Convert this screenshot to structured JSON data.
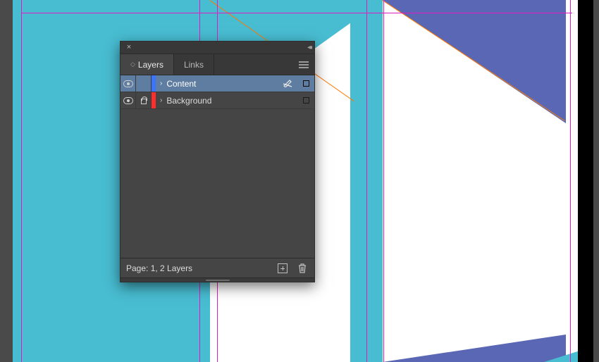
{
  "panel": {
    "tabs": [
      {
        "label": "Layers",
        "active": true
      },
      {
        "label": "Links",
        "active": false
      }
    ],
    "layers": [
      {
        "name": "Content",
        "color": "#3a74ff",
        "visible": true,
        "locked": false,
        "selected": true,
        "pen_disabled": true
      },
      {
        "name": "Background",
        "color": "#ff2d2d",
        "visible": true,
        "locked": true,
        "selected": false,
        "pen_disabled": false
      }
    ],
    "footer_status": "Page: 1, 2 Layers"
  },
  "icons": {
    "close": "×",
    "collapse": "◂◂",
    "disclosure": "›",
    "pen_slash": "✎"
  }
}
